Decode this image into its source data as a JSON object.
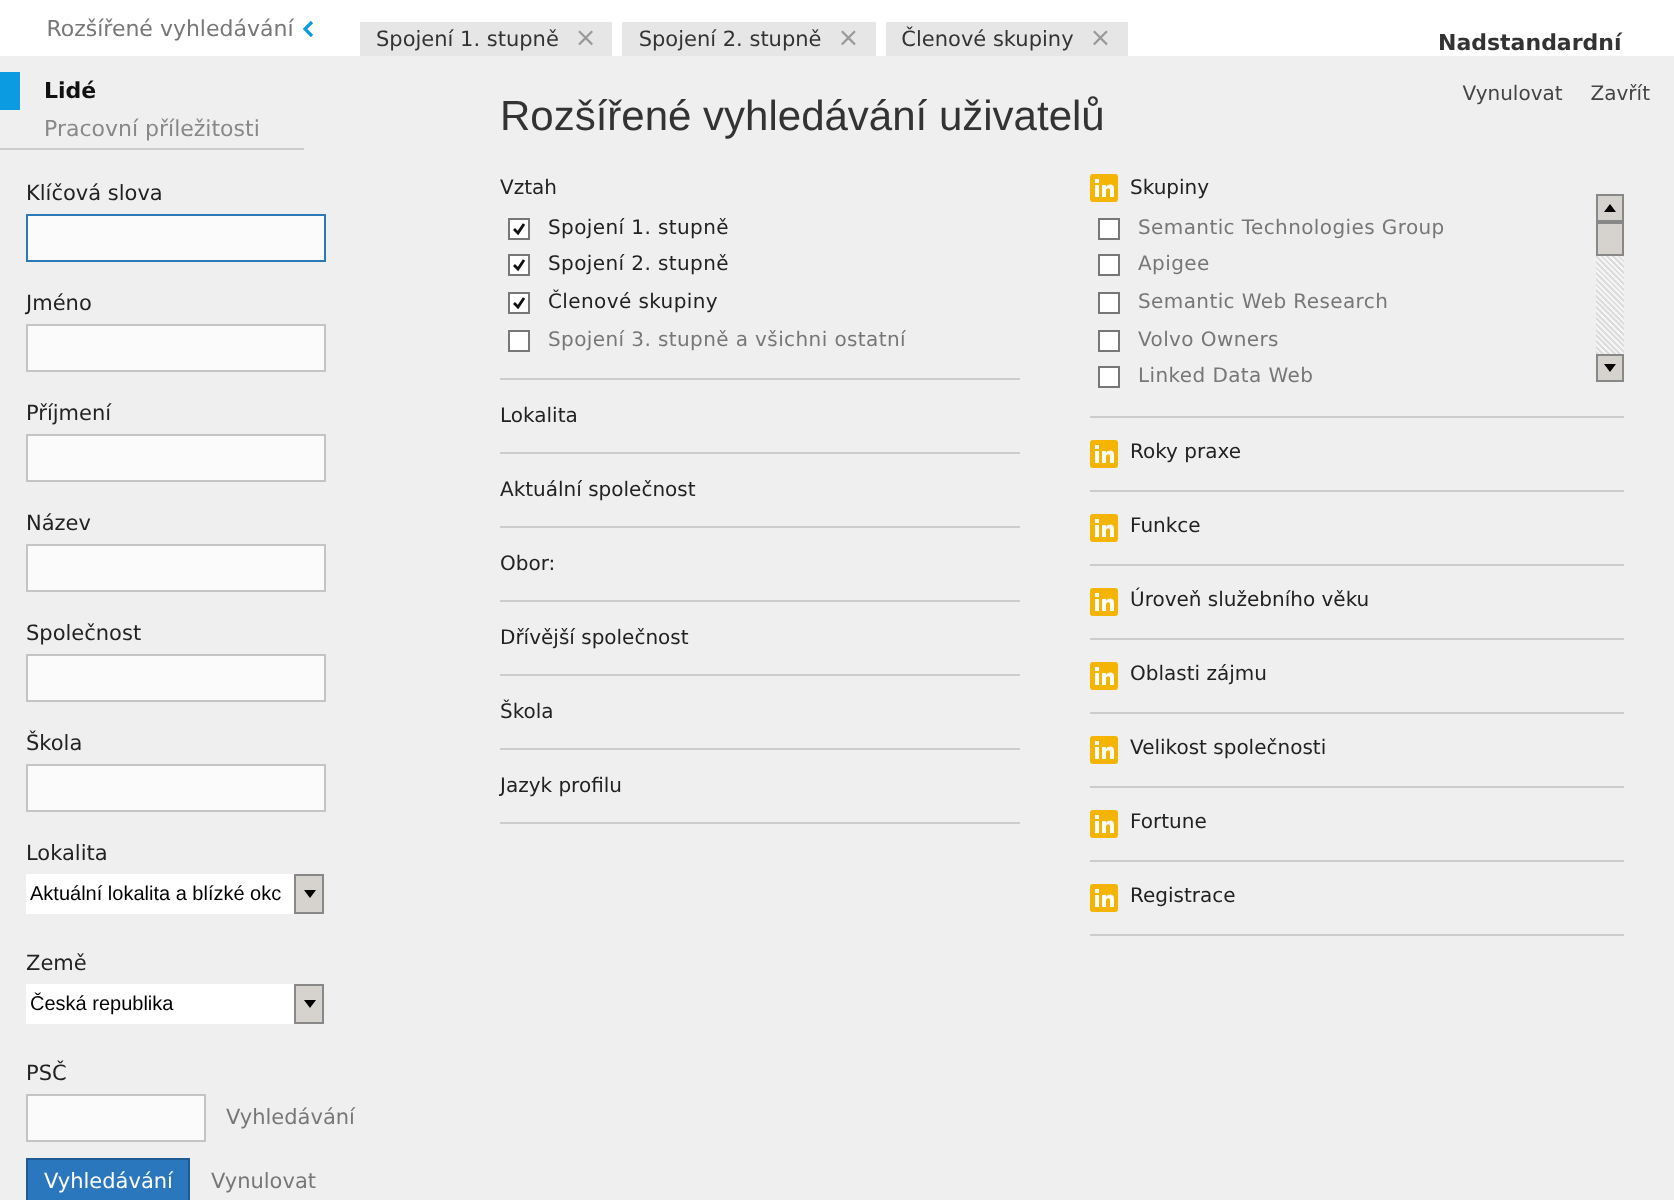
{
  "top_bar": {
    "breadcrumb": "Rozšířené vyhledávání",
    "tabs": [
      {
        "label": "Spojení 1. stupně",
        "close": "×"
      },
      {
        "label": "Spojení 2. stupně",
        "close": "×"
      },
      {
        "label": "Členové skupiny",
        "close": "×"
      }
    ],
    "right_heading": "Nadstandardní"
  },
  "sidebar": {
    "nav": [
      {
        "label": "Lidé",
        "selected": true
      },
      {
        "label": "Pracovní příležitosti",
        "selected": false
      }
    ],
    "fields": [
      {
        "kind": "input",
        "label": "Klíčová slova",
        "focused": true
      },
      {
        "kind": "input",
        "label": "Jméno",
        "focused": false
      },
      {
        "kind": "input",
        "label": "Příjmení",
        "focused": false
      },
      {
        "kind": "input",
        "label": "Název",
        "focused": false
      },
      {
        "kind": "input",
        "label": "Společnost",
        "focused": false
      },
      {
        "kind": "input",
        "label": "Škola",
        "focused": false
      },
      {
        "kind": "select",
        "label": "Lokalita",
        "value": "Aktuální lokalita a blízké okc"
      },
      {
        "kind": "select",
        "label": "Země",
        "value": "Česká republika"
      },
      {
        "kind": "postal",
        "label": "PSČ",
        "link": "Vyhledávání"
      }
    ],
    "search_button": "Vyhledávání",
    "reset_link": "Vynulovat"
  },
  "dialog": {
    "title": "Rozšířené vyhledávání uživatelů",
    "actions": [
      "Vynulovat",
      "Zavřít"
    ],
    "columns": [
      [
        {
          "kind": "checklist",
          "title": "Vztah",
          "options": [
            {
              "label": "Spojení 1. stupně",
              "checked": true
            },
            {
              "label": "Spojení 2. stupně",
              "checked": true
            },
            {
              "label": "Členové skupiny",
              "checked": true
            },
            {
              "label": "Spojení 3. stupně a všichni ostatní",
              "checked": false
            }
          ]
        },
        {
          "kind": "heading",
          "title": "Lokalita"
        },
        {
          "kind": "heading",
          "title": "Aktuální společnost"
        },
        {
          "kind": "heading",
          "title": "Obor:"
        },
        {
          "kind": "heading",
          "title": "Dřívější společnost"
        },
        {
          "kind": "heading",
          "title": "Škola"
        },
        {
          "kind": "heading",
          "title": "Jazyk profilu"
        }
      ],
      [
        {
          "kind": "checklist",
          "title": "Skupiny",
          "premium": true,
          "scroll": true,
          "options": [
            {
              "label": "Semantic Technologies Group",
              "checked": false
            },
            {
              "label": "Apigee",
              "checked": false
            },
            {
              "label": "Semantic Web Research",
              "checked": false
            },
            {
              "label": "Volvo Owners",
              "checked": false
            },
            {
              "label": "Linked Data Web",
              "checked": false
            }
          ]
        },
        {
          "kind": "heading",
          "title": "Roky praxe",
          "premium": true
        },
        {
          "kind": "heading",
          "title": "Funkce",
          "premium": true
        },
        {
          "kind": "heading",
          "title": "Úroveň služebního věku",
          "premium": true
        },
        {
          "kind": "heading",
          "title": "Oblasti zájmu",
          "premium": true
        },
        {
          "kind": "heading",
          "title": "Velikost společnosti",
          "premium": true
        },
        {
          "kind": "heading",
          "title": "Fortune",
          "premium": true
        },
        {
          "kind": "heading",
          "title": "Registrace",
          "premium": true
        }
      ]
    ]
  }
}
